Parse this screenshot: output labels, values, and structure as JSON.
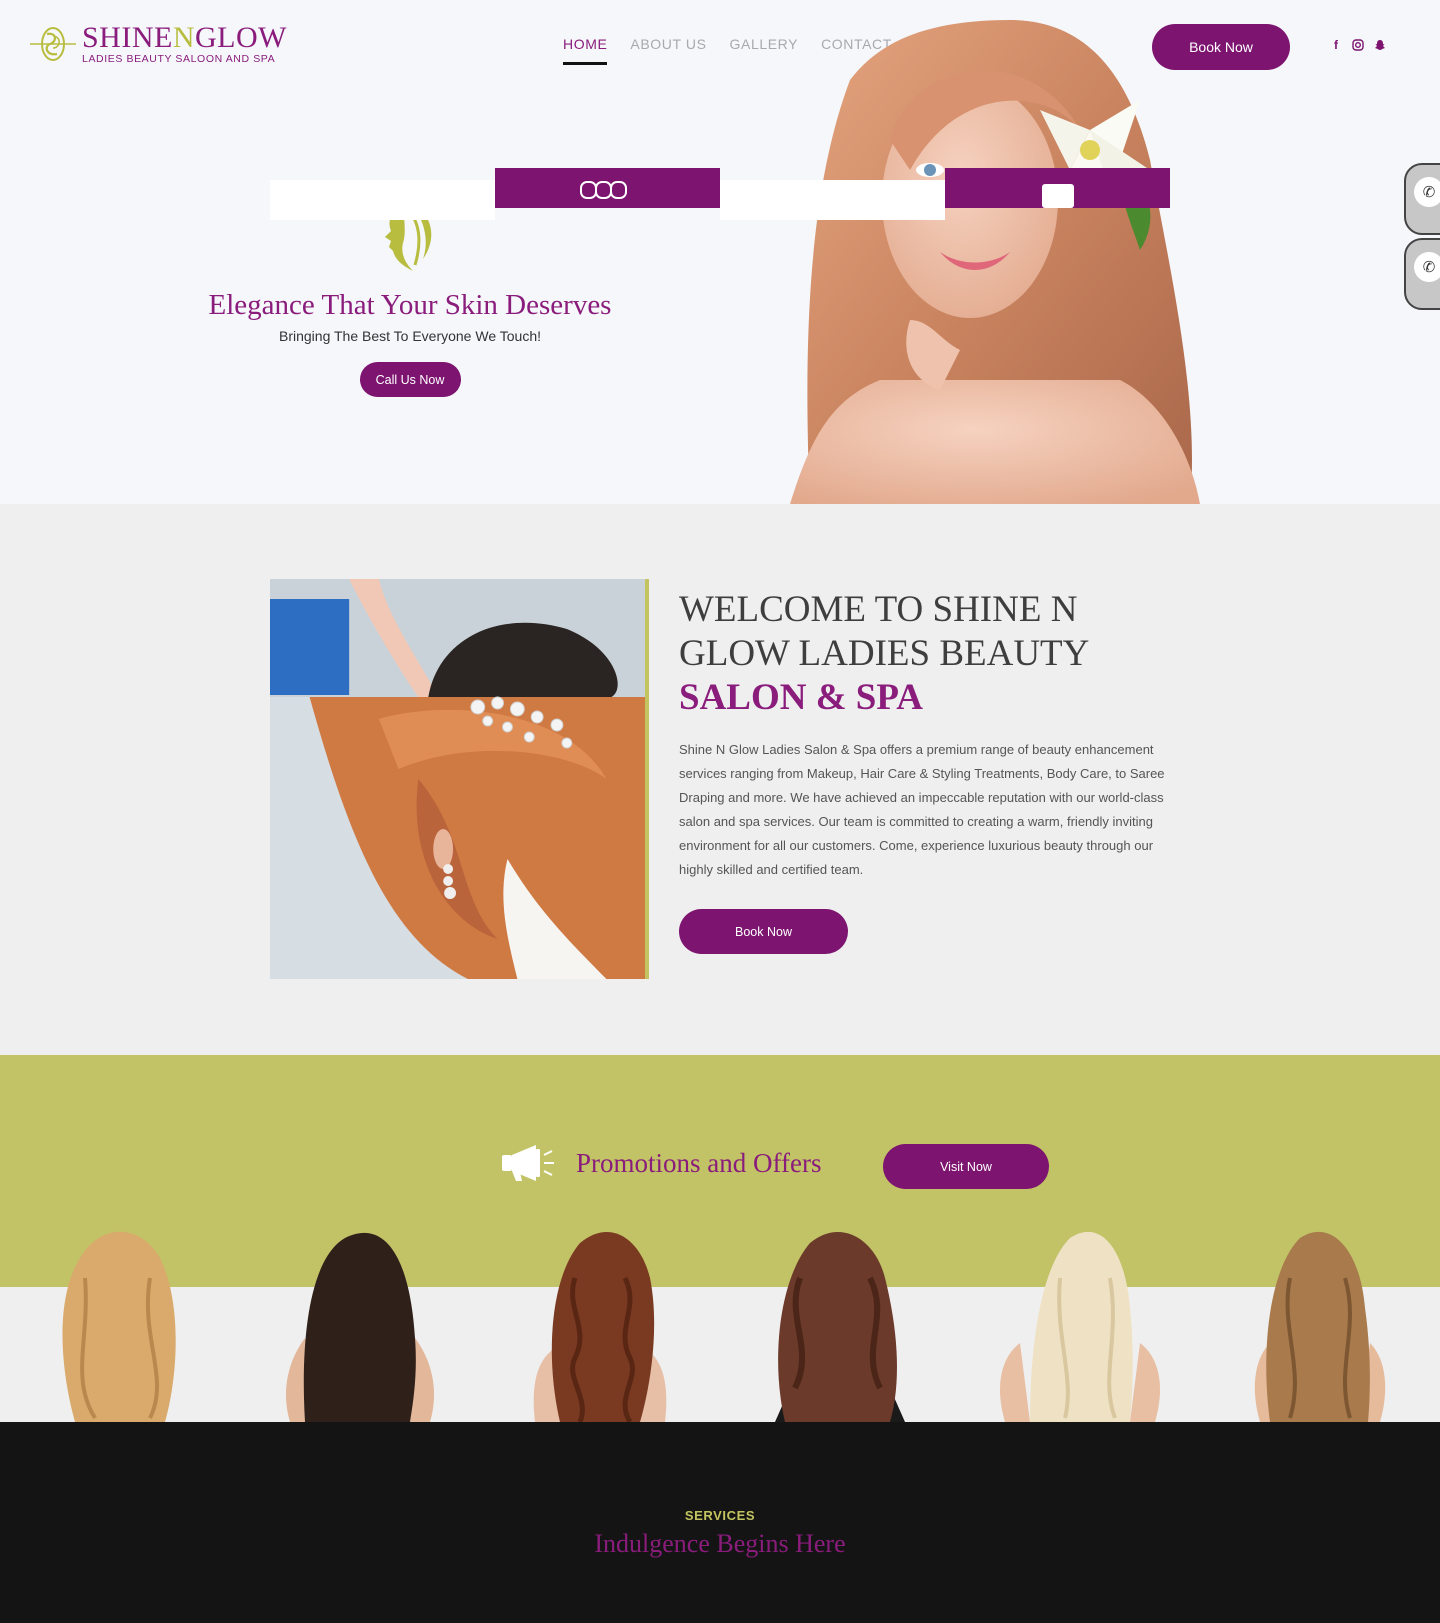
{
  "brand": {
    "name_a": "SHINE",
    "name_b": "N",
    "name_c": "GLOW",
    "tagline": "LADIES BEAUTY SALOON AND SPA"
  },
  "nav": {
    "items": [
      {
        "label": "HOME",
        "active": true
      },
      {
        "label": "ABOUT US",
        "active": false
      },
      {
        "label": "GALLERY",
        "active": false
      },
      {
        "label": "CONTACT",
        "active": false
      }
    ]
  },
  "header": {
    "book_label": "Book Now",
    "social_icons": [
      "facebook-icon",
      "instagram-icon",
      "snapchat-icon"
    ]
  },
  "hero": {
    "title": "Elegance That Your Skin Deserves",
    "subtitle": "Bringing The Best To Everyone We Touch!",
    "cta_label": "Call Us Now"
  },
  "welcome": {
    "title_line1": "WELCOME TO SHINE N",
    "title_line2": "GLOW LADIES BEAUTY",
    "title_accent": "SALON & SPA",
    "paragraph": "Shine N Glow Ladies Salon & Spa offers a premium range of beauty enhancement services ranging from Makeup, Hair Care & Styling Treatments, Body Care, to Saree Draping and more. We have achieved an impeccable reputation with our world-class salon and spa services. Our team is committed to creating a warm, friendly inviting environment for all our customers. Come, experience luxurious beauty through our highly skilled and certified team.",
    "cta_label": "Book Now"
  },
  "promotions": {
    "title": "Promotions and Offers",
    "cta_label": "Visit Now"
  },
  "services": {
    "eyebrow": "SERVICES",
    "title": "Indulgence Begins Here"
  },
  "colors": {
    "brand_purple": "#7d1470",
    "brand_olive": "#c2c366",
    "dark": "#141414"
  }
}
